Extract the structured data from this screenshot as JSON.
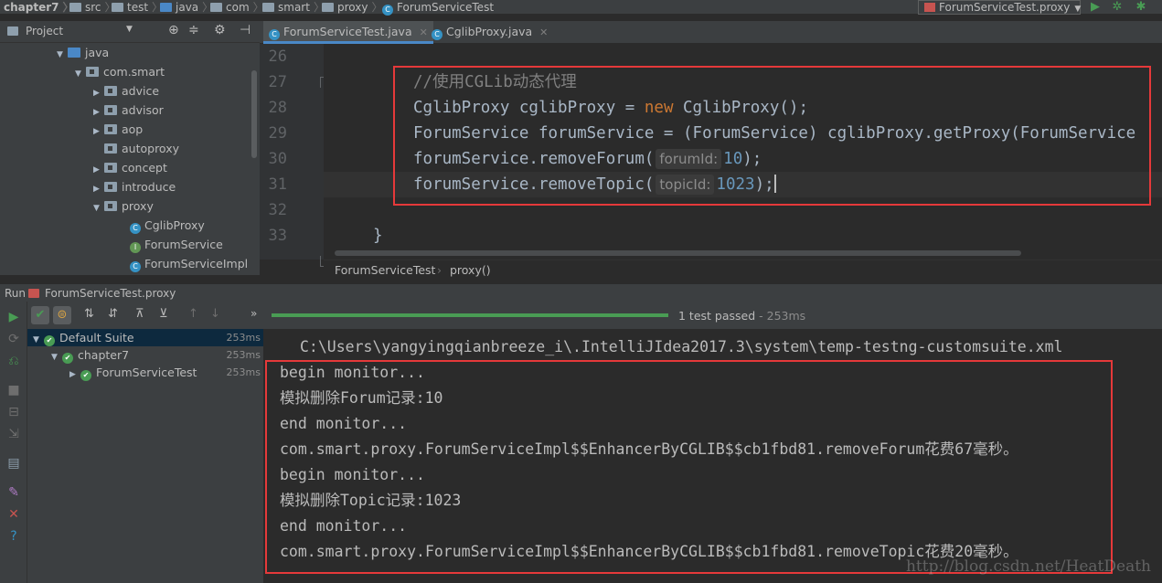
{
  "navbar": {
    "crumbs": [
      "chapter7",
      "src",
      "test",
      "java",
      "com",
      "smart",
      "proxy",
      "ForumServiceTest"
    ],
    "run_config": "ForumServiceTest.proxy"
  },
  "project": {
    "title": "Project",
    "tree": [
      {
        "label": "java",
        "icon": "folder-icon"
      },
      {
        "label": "com.smart",
        "icon": "package-icon"
      },
      {
        "label": "advice",
        "icon": "package-icon"
      },
      {
        "label": "advisor",
        "icon": "package-icon"
      },
      {
        "label": "aop",
        "icon": "package-icon"
      },
      {
        "label": "autoproxy",
        "icon": "package-icon"
      },
      {
        "label": "concept",
        "icon": "package-icon"
      },
      {
        "label": "introduce",
        "icon": "package-icon"
      },
      {
        "label": "proxy",
        "icon": "package-icon"
      },
      {
        "label": "CglibProxy",
        "icon": "class-icon"
      },
      {
        "label": "ForumService",
        "icon": "interface-icon"
      },
      {
        "label": "ForumServiceImpl",
        "icon": "class-icon"
      }
    ]
  },
  "editor": {
    "tabs": [
      "ForumServiceTest.java",
      "CglibProxy.java"
    ],
    "line_numbers": [
      "26",
      "27",
      "28",
      "29",
      "30",
      "31",
      "32",
      "33"
    ],
    "code": {
      "comment": "//使用CGLib动态代理",
      "l28_a": "CglibProxy cglibProxy = ",
      "l28_kw": "new",
      "l28_b": " CglibProxy();",
      "l29": "ForumService forumService = (ForumService) cglibProxy.getProxy(ForumService",
      "l30_a": "forumService.removeForum(",
      "l30_hint": "forumId:",
      "l30_num": "10",
      "l30_b": ");",
      "l31_a": "forumService.removeTopic(",
      "l31_hint": "topicId:",
      "l31_num": "1023",
      "l31_b": ");",
      "l33": "}"
    },
    "breadcrumb": [
      "ForumServiceTest",
      "proxy()"
    ]
  },
  "run": {
    "label": "Run",
    "config": "ForumServiceTest.proxy",
    "status": "1 test passed",
    "status_time": " - 253ms",
    "progress": 1.0,
    "results": [
      {
        "label": "Default Suite",
        "time": "253ms"
      },
      {
        "label": "chapter7",
        "time": "253ms"
      },
      {
        "label": "ForumServiceTest",
        "time": "253ms"
      }
    ],
    "console_path": "C:\\Users\\yangyingqianbreeze_i\\.IntelliJIdea2017.3\\system\\temp-testng-customsuite.xml",
    "console_lines": [
      "begin monitor...",
      "模拟删除Forum记录:10",
      "end monitor...",
      "com.smart.proxy.ForumServiceImpl$$EnhancerByCGLIB$$cb1fbd81.removeForum花费67毫秒。",
      "begin monitor...",
      "模拟删除Topic记录:1023",
      "end monitor...",
      "com.smart.proxy.ForumServiceImpl$$EnhancerByCGLIB$$cb1fbd81.removeTopic花费20毫秒。"
    ]
  },
  "watermark": "http://blog.csdn.net/HeatDeath",
  "colors": {
    "accent": "#4a88c7",
    "pass": "#499c54",
    "highlight_box": "#e5393a"
  }
}
